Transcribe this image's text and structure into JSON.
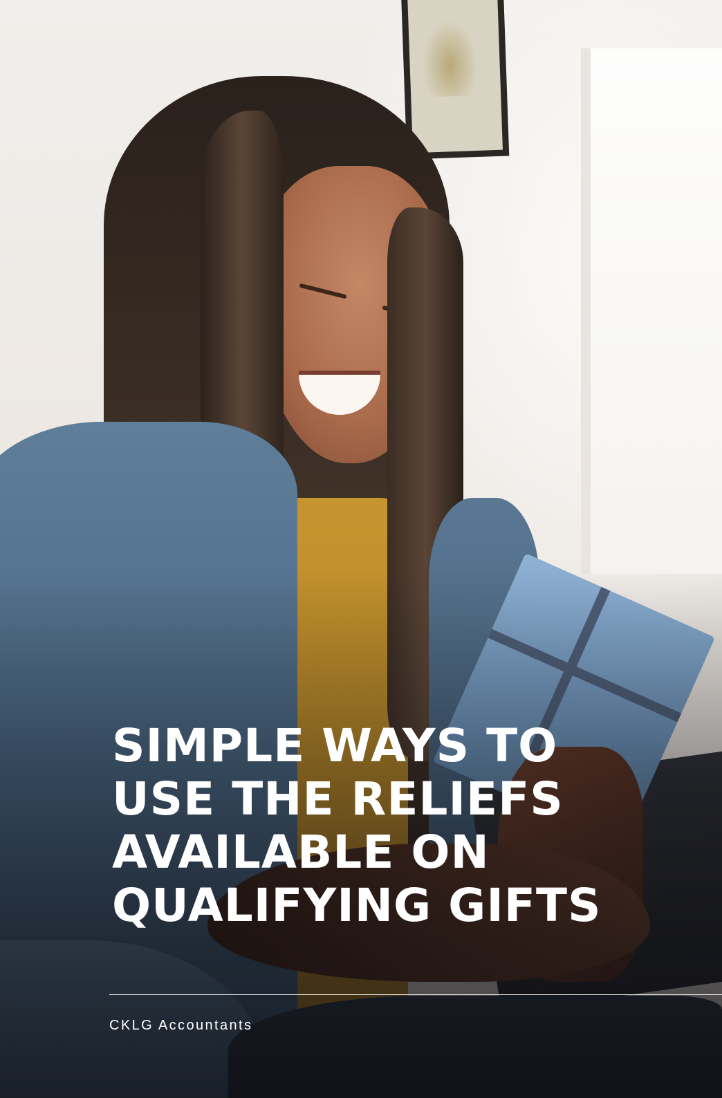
{
  "headline": {
    "lines": [
      "SIMPLE WAYS TO",
      "USE THE RELIEFS",
      "AVAILABLE ON",
      "QUALIFYING GIFTS"
    ]
  },
  "footer": {
    "brand": "CKLG Accountants"
  },
  "colors": {
    "text": "#ffffff",
    "jacket": "#4a6782",
    "gift_box": "#7097bd",
    "shirt": "#c6952e"
  }
}
